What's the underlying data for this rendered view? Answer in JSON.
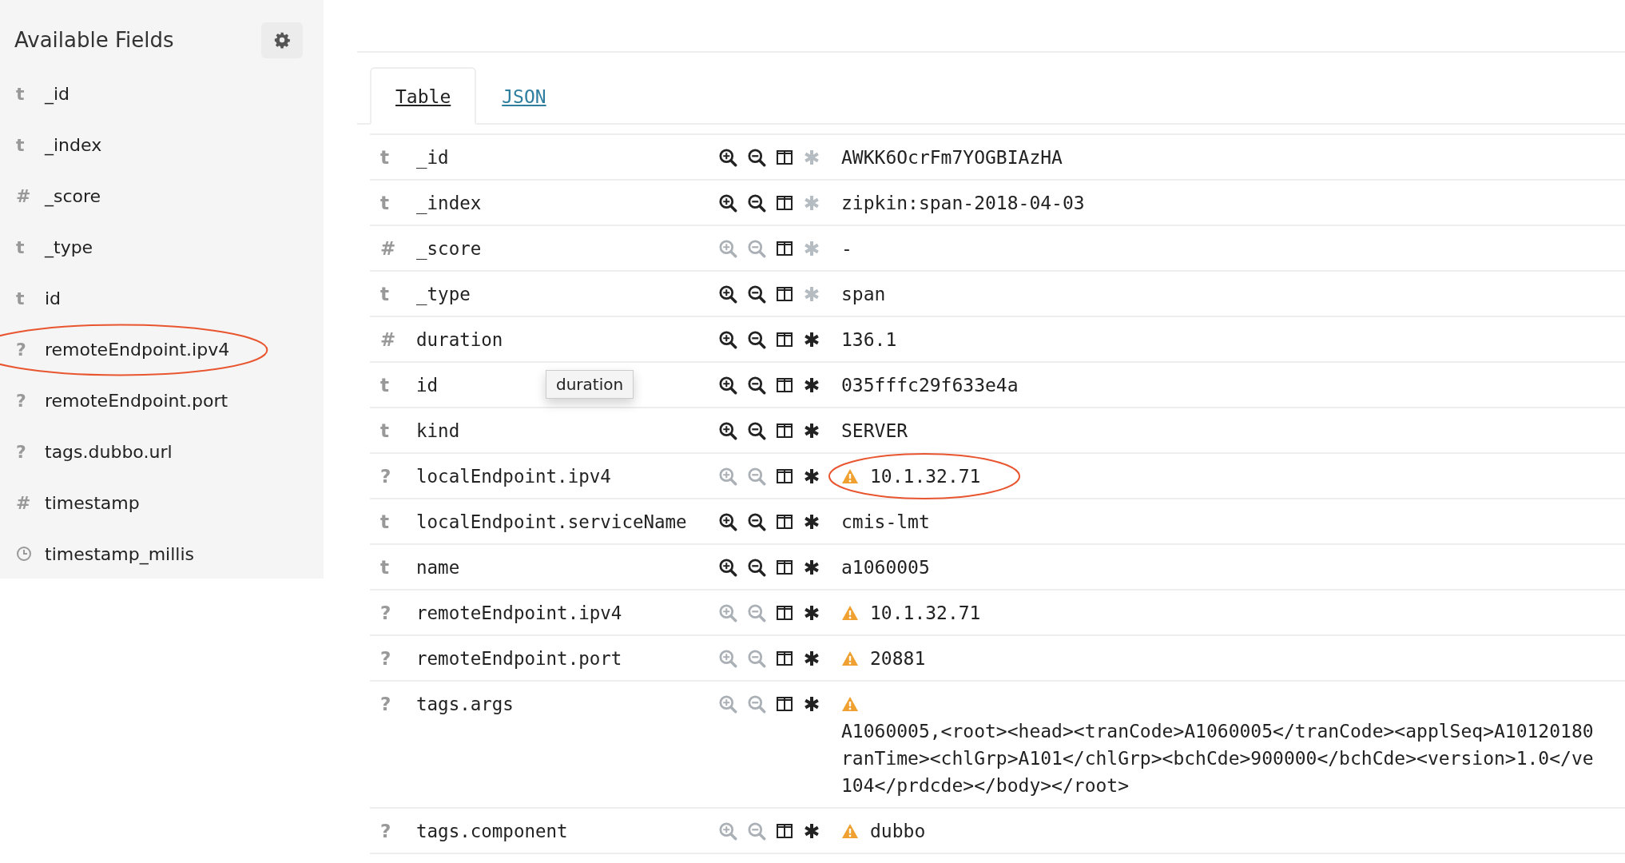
{
  "sidebar": {
    "title": "Available Fields",
    "items": [
      {
        "type_label": "t",
        "name": "_id",
        "highlighted": false
      },
      {
        "type_label": "t",
        "name": "_index",
        "highlighted": false
      },
      {
        "type_label": "#",
        "name": "_score",
        "highlighted": false
      },
      {
        "type_label": "t",
        "name": "_type",
        "highlighted": false
      },
      {
        "type_label": "t",
        "name": "id",
        "highlighted": false
      },
      {
        "type_label": "?",
        "name": "remoteEndpoint.ipv4",
        "highlighted": true
      },
      {
        "type_label": "?",
        "name": "remoteEndpoint.port",
        "highlighted": false
      },
      {
        "type_label": "?",
        "name": "tags.dubbo.url",
        "highlighted": false
      },
      {
        "type_label": "#",
        "name": "timestamp",
        "highlighted": false
      },
      {
        "kind": "clock",
        "name": "timestamp_millis",
        "highlighted": false
      }
    ]
  },
  "tabs": [
    {
      "label": "Table",
      "selected": true
    },
    {
      "label": "JSON",
      "selected": false
    }
  ],
  "rows": [
    {
      "type_label": "t",
      "field": "_id",
      "filterable": true,
      "meta": true,
      "warning": false,
      "highlighted": false,
      "value_lines": [
        "AWKK6OcrFm7YOGBIAzHA"
      ]
    },
    {
      "type_label": "t",
      "field": "_index",
      "filterable": true,
      "meta": true,
      "warning": false,
      "highlighted": false,
      "value_lines": [
        "zipkin:span-2018-04-03"
      ]
    },
    {
      "type_label": "#",
      "field": "_score",
      "filterable": false,
      "meta": true,
      "warning": false,
      "highlighted": false,
      "value_lines": [
        " -"
      ]
    },
    {
      "type_label": "t",
      "field": "_type",
      "filterable": true,
      "meta": true,
      "warning": false,
      "highlighted": false,
      "value_lines": [
        "span"
      ]
    },
    {
      "type_label": "#",
      "field": "duration",
      "filterable": true,
      "meta": false,
      "warning": false,
      "highlighted": false,
      "value_lines": [
        "136.1"
      ]
    },
    {
      "type_label": "t",
      "field": "id",
      "filterable": true,
      "meta": false,
      "warning": false,
      "highlighted": false,
      "tooltip": "duration",
      "value_lines": [
        "035fffc29f633e4a"
      ]
    },
    {
      "type_label": "t",
      "field": "kind",
      "filterable": true,
      "meta": false,
      "warning": false,
      "highlighted": false,
      "value_lines": [
        "SERVER"
      ]
    },
    {
      "type_label": "?",
      "field": "localEndpoint.ipv4",
      "filterable": false,
      "meta": false,
      "warning": true,
      "highlighted": true,
      "value_lines": [
        "10.1.32.71"
      ]
    },
    {
      "type_label": "t",
      "field": "localEndpoint.serviceName",
      "filterable": true,
      "meta": false,
      "warning": false,
      "highlighted": false,
      "value_lines": [
        "cmis-lmt"
      ]
    },
    {
      "type_label": "t",
      "field": "name",
      "filterable": true,
      "meta": false,
      "warning": false,
      "highlighted": false,
      "value_lines": [
        "a1060005"
      ]
    },
    {
      "type_label": "?",
      "field": "remoteEndpoint.ipv4",
      "filterable": false,
      "meta": false,
      "warning": true,
      "highlighted": false,
      "value_lines": [
        "10.1.32.71"
      ]
    },
    {
      "type_label": "?",
      "field": "remoteEndpoint.port",
      "filterable": false,
      "meta": false,
      "warning": true,
      "highlighted": false,
      "value_lines": [
        "20881"
      ]
    },
    {
      "type_label": "?",
      "field": "tags.args",
      "filterable": false,
      "meta": false,
      "warning": true,
      "highlighted": false,
      "value_lines": [
        "A1060005,<root><head><tranCode>A1060005</tranCode><applSeq>A10120180",
        "ranTime><chlGrp>A101</chlGrp><bchCde>900000</bchCde><version>1.0</ve",
        "104</prdcde></body></root>"
      ]
    },
    {
      "type_label": "?",
      "field": "tags.component",
      "filterable": false,
      "meta": false,
      "warning": true,
      "highlighted": false,
      "value_lines": [
        "dubbo"
      ]
    }
  ]
}
